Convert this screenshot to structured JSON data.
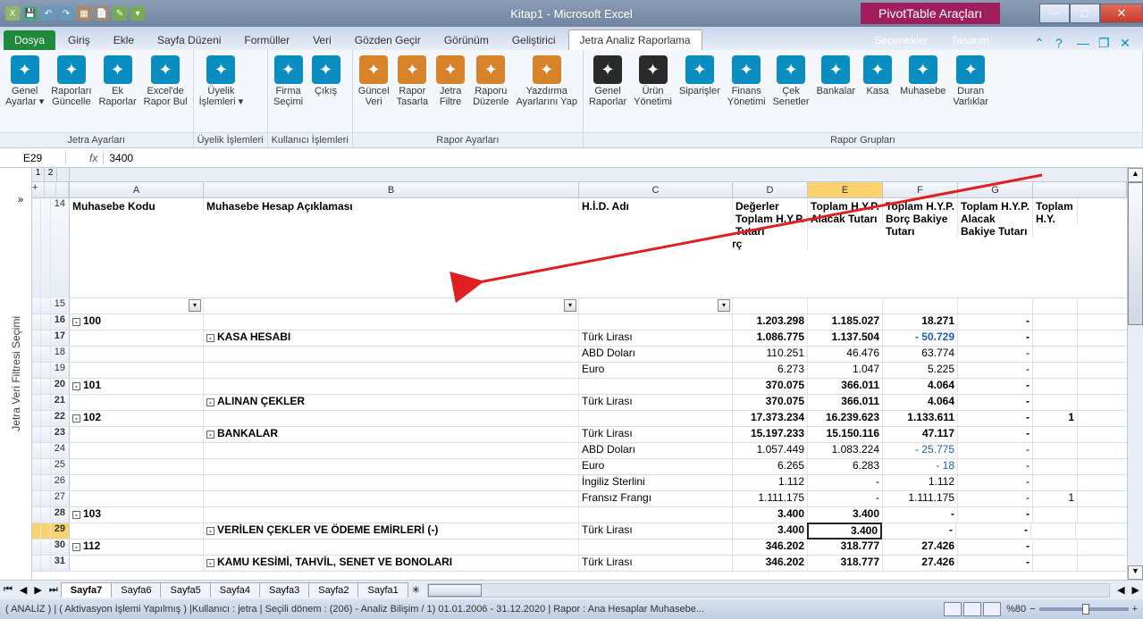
{
  "title": "Kitap1 - Microsoft Excel",
  "pivot_context": "PivotTable Araçları",
  "tabs": {
    "file": "Dosya",
    "list": [
      "Giriş",
      "Ekle",
      "Sayfa Düzeni",
      "Formüller",
      "Veri",
      "Gözden Geçir",
      "Görünüm",
      "Geliştirici",
      "Jetra Analiz Raporlama"
    ],
    "context": [
      "Seçenekler",
      "Tasarım"
    ],
    "active": "Jetra Analiz Raporlama"
  },
  "ribbon": {
    "g1": {
      "label": "Jetra Ayarları",
      "btns": [
        [
          "Genel",
          "Ayarlar ▾"
        ],
        [
          "Raporları",
          "Güncelle"
        ],
        [
          "Ek",
          "Raporlar"
        ],
        [
          "Excel'de",
          "Rapor Bul"
        ]
      ]
    },
    "g2": {
      "label": "Üyelik İşlemleri",
      "btns": [
        [
          "Üyelik",
          "İşlemleri ▾"
        ]
      ]
    },
    "g3": {
      "label": "Kullanıcı İşlemleri",
      "btns": [
        [
          "Firma",
          "Seçimi"
        ],
        [
          "Çıkış",
          ""
        ]
      ]
    },
    "g4": {
      "label": "Rapor Ayarları",
      "btns": [
        [
          "Güncel",
          "Veri"
        ],
        [
          "Rapor",
          "Tasarla"
        ],
        [
          "Jetra",
          "Filtre"
        ],
        [
          "Raporu",
          "Düzenle"
        ],
        [
          "Yazdırma",
          "Ayarlarını Yap"
        ]
      ]
    },
    "g5": {
      "label": "Rapor Grupları",
      "btns": [
        [
          "Genel",
          "Raporlar"
        ],
        [
          "Ürün",
          "Yönetimi"
        ],
        [
          "Siparişler",
          ""
        ],
        [
          "Finans",
          "Yönetimi"
        ],
        [
          "Çek",
          "Senetler"
        ],
        [
          "Bankalar",
          ""
        ],
        [
          "Kasa",
          ""
        ],
        [
          "Muhasebe",
          ""
        ],
        [
          "Duran",
          "Varlıklar"
        ]
      ]
    }
  },
  "namebox": "E29",
  "formula": "3400",
  "side_panel": "Jetra Veri Filtresi Seçimi",
  "col_headers": [
    "A",
    "B",
    "C",
    "D",
    "E",
    "F",
    "G"
  ],
  "headers": {
    "A": "Muhasebe Kodu",
    "B": "Muhasebe Hesap Açıklaması",
    "C": "H.İ.D. Adı",
    "D": "Değerler Toplam H.Y.P. Tutarı",
    "Dborc": "Borç",
    "E": "Toplam H.Y.P. Alacak Tutarı",
    "F": "Toplam H.Y.P. Borç Bakiye Tutarı",
    "G": "Toplam H.Y.P. Alacak Bakiye Tutarı",
    "H": "Toplam H.Y."
  },
  "rows": [
    {
      "r": 16,
      "A": "100",
      "exp": true,
      "bold": true,
      "B": "",
      "C": "",
      "D": "1.203.298",
      "E": "1.185.027",
      "F": "18.271",
      "G": "-"
    },
    {
      "r": 17,
      "A": "",
      "B": "KASA HESABI",
      "exp": true,
      "bold": true,
      "C": "Türk Lirası",
      "D": "1.086.775",
      "E": "1.137.504",
      "F": "- 50.729",
      "Fblue": true,
      "G": "-"
    },
    {
      "r": 18,
      "A": "",
      "B": "",
      "C": "ABD Doları",
      "D": "110.251",
      "E": "46.476",
      "F": "63.774",
      "G": "-"
    },
    {
      "r": 19,
      "A": "",
      "B": "",
      "C": "Euro",
      "D": "6.273",
      "E": "1.047",
      "F": "5.225",
      "G": "-"
    },
    {
      "r": 20,
      "A": "101",
      "exp": true,
      "bold": true,
      "B": "",
      "C": "",
      "D": "370.075",
      "E": "366.011",
      "F": "4.064",
      "G": "-"
    },
    {
      "r": 21,
      "A": "",
      "B": "ALINAN ÇEKLER",
      "exp": true,
      "bold": true,
      "C": "Türk Lirası",
      "D": "370.075",
      "E": "366.011",
      "F": "4.064",
      "G": "-"
    },
    {
      "r": 22,
      "A": "102",
      "exp": true,
      "bold": true,
      "B": "",
      "C": "",
      "D": "17.373.234",
      "E": "16.239.623",
      "F": "1.133.611",
      "G": "-",
      "H": "1"
    },
    {
      "r": 23,
      "A": "",
      "B": "BANKALAR",
      "exp": true,
      "bold": true,
      "C": "Türk Lirası",
      "D": "15.197.233",
      "E": "15.150.116",
      "F": "47.117",
      "G": "-"
    },
    {
      "r": 24,
      "A": "",
      "B": "",
      "C": "ABD Doları",
      "D": "1.057.449",
      "E": "1.083.224",
      "F": "- 25.775",
      "Fblue": true,
      "G": "-"
    },
    {
      "r": 25,
      "A": "",
      "B": "",
      "C": "Euro",
      "D": "6.265",
      "E": "6.283",
      "F": "- 18",
      "Fblue": true,
      "G": "-"
    },
    {
      "r": 26,
      "A": "",
      "B": "",
      "C": "İngiliz Sterlini",
      "D": "1.112",
      "E": "-",
      "F": "1.112",
      "G": "-"
    },
    {
      "r": 27,
      "A": "",
      "B": "",
      "C": "Fransız Frangı",
      "D": "1.111.175",
      "E": "-",
      "F": "1.111.175",
      "G": "-",
      "H": "1"
    },
    {
      "r": 28,
      "A": "103",
      "exp": true,
      "bold": true,
      "B": "",
      "C": "",
      "D": "3.400",
      "E": "3.400",
      "F": "-",
      "G": "-"
    },
    {
      "r": 29,
      "A": "",
      "B": "VERİLEN ÇEKLER VE ÖDEME EMİRLERİ (-)",
      "exp": true,
      "bold": true,
      "C": "Türk Lirası",
      "D": "3.400",
      "E": "3.400",
      "Esel": true,
      "F": "-",
      "G": "-",
      "active": true
    },
    {
      "r": 30,
      "A": "112",
      "exp": true,
      "bold": true,
      "B": "",
      "C": "",
      "D": "346.202",
      "E": "318.777",
      "F": "27.426",
      "G": "-"
    },
    {
      "r": 31,
      "A": "",
      "B": "KAMU KESİMİ, TAHVİL, SENET VE BONOLARI",
      "exp": true,
      "bold": true,
      "C": "Türk Lirası",
      "D": "346.202",
      "E": "318.777",
      "F": "27.426",
      "G": "-"
    }
  ],
  "row14": 14,
  "row15": 15,
  "sheets": [
    "Sayfa7",
    "Sayfa6",
    "Sayfa5",
    "Sayfa4",
    "Sayfa3",
    "Sayfa2",
    "Sayfa1"
  ],
  "active_sheet": "Sayfa7",
  "status_text": "( ANALİZ ) | ( Aktivasyon İşlemi Yapılmış ) |Kullanıcı : jetra | Seçili dönem : (206) - Analiz Bilişim / 1) 01.01.2006 - 31.12.2020  | Rapor : Ana Hesaplar Muhasebe...",
  "zoom": "%80"
}
